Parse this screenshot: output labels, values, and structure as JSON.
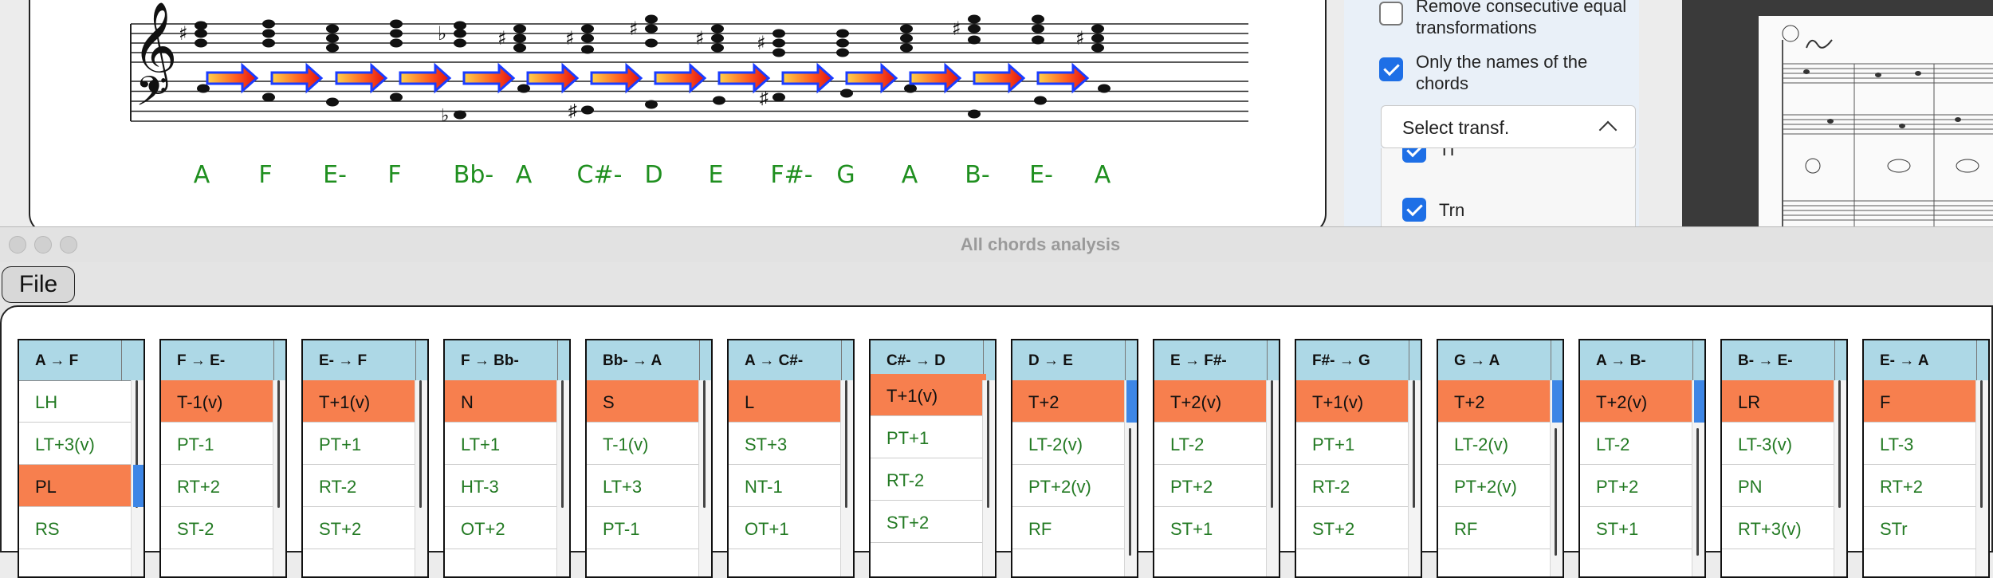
{
  "score": {
    "chord_names": [
      "A",
      "F",
      "E-",
      "F",
      "Bb-",
      "A",
      "C#-",
      "D",
      "E",
      "F#-",
      "G",
      "A",
      "B-",
      "E-",
      "A"
    ]
  },
  "side_panel": {
    "remove_label": "Remove consecutive equal transformations",
    "only_names_label": "Only the names of the chords",
    "select_label": "Select transf.",
    "options": [
      "TI",
      "Trn"
    ]
  },
  "window": {
    "title": "All chords analysis",
    "menu_file": "File"
  },
  "columns": [
    {
      "header": "A → F",
      "items": [
        "LH",
        "LT+3(v)",
        "PL",
        "RS"
      ],
      "selected": 2
    },
    {
      "header": "F → E-",
      "items": [
        "T-1(v)",
        "PT-1",
        "RT+2",
        "ST-2"
      ],
      "selected": 0
    },
    {
      "header": "E- → F",
      "items": [
        "T+1(v)",
        "PT+1",
        "RT-2",
        "ST+2"
      ],
      "selected": 0
    },
    {
      "header": "F → Bb-",
      "items": [
        "N",
        "LT+1",
        "HT-3",
        "OT+2"
      ],
      "selected": 0
    },
    {
      "header": "Bb- → A",
      "items": [
        "S",
        "T-1(v)",
        "LT+3",
        "PT-1"
      ],
      "selected": 0
    },
    {
      "header": "A → C#-",
      "items": [
        "L",
        "ST+3",
        "NT-1",
        "OT+1"
      ],
      "selected": 0
    },
    {
      "header": "C#- → D",
      "items": [
        "T+1(v)",
        "PT+1",
        "RT-2",
        "ST+2"
      ],
      "selected": 0
    },
    {
      "header": "D → E",
      "items": [
        "T+2",
        "LT-2(v)",
        "PT+2(v)",
        "RF"
      ],
      "selected": 0
    },
    {
      "header": "E → F#-",
      "items": [
        "T+2(v)",
        "LT-2",
        "PT+2",
        "ST+1"
      ],
      "selected": 0
    },
    {
      "header": "F#- → G",
      "items": [
        "T+1(v)",
        "PT+1",
        "RT-2",
        "ST+2"
      ],
      "selected": 0
    },
    {
      "header": "G → A",
      "items": [
        "T+2",
        "LT-2(v)",
        "PT+2(v)",
        "RF"
      ],
      "selected": 0
    },
    {
      "header": "A → B-",
      "items": [
        "T+2(v)",
        "LT-2",
        "PT+2",
        "ST+1"
      ],
      "selected": 0
    },
    {
      "header": "B- → E-",
      "items": [
        "LR",
        "LT-3(v)",
        "PN",
        "RT+3(v)"
      ],
      "selected": 0
    },
    {
      "header": "E- → A",
      "items": [
        "F",
        "LT-3",
        "RT+2",
        "STr"
      ],
      "selected": 0
    }
  ],
  "colors": {
    "header_bg": "#add8e6",
    "selected_bg": "#f77f4e",
    "item_text": "#237a23",
    "chord_name": "#1f8f1f",
    "checkbox_blue": "#1e6fe6"
  }
}
